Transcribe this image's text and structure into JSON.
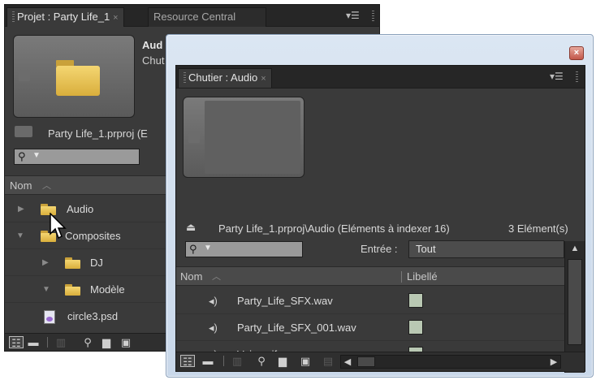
{
  "project_panel": {
    "tab_active": "Projet : Party Life_1",
    "tab_inactive": "Resource Central",
    "tab_close": "×",
    "menu_icon": "panel-menu-icon",
    "preview_title": "Aud",
    "preview_sub": "Chut",
    "project_path": "Party Life_1.prproj (E",
    "column_name": "Nom",
    "items": [
      {
        "name": "Audio",
        "type": "folder",
        "expanded": false
      },
      {
        "name": "Composites",
        "type": "folder",
        "expanded": true
      },
      {
        "name": "DJ",
        "type": "folder",
        "expanded": false
      },
      {
        "name": "Modèle",
        "type": "folder",
        "expanded": true
      },
      {
        "name": "circle3.psd",
        "type": "psd-file"
      }
    ]
  },
  "bin_panel": {
    "tab_title": "Chutier : Audio",
    "tab_close": "×",
    "close_button": "×",
    "path": "Party Life_1.prproj\\Audio (Eléments à indexer 16)",
    "count": "3 Elément(s)",
    "entry_label": "Entrée :",
    "entry_value": "Tout",
    "column_name": "Nom",
    "column_label": "Libellé",
    "files": [
      {
        "name": "Party_Life_SFX.wav",
        "label_color": "#b9c8b3"
      },
      {
        "name": "Party_Life_SFX_001.wav",
        "label_color": "#b9c8b3"
      },
      {
        "name": "Voice.aif",
        "label_color": "#b9c8b3"
      }
    ]
  },
  "colors": {
    "panel_bg": "#3a3a3a",
    "folder": "#e8c25a",
    "window_frame": "#dbe6f3",
    "close_button": "#c2574a"
  }
}
